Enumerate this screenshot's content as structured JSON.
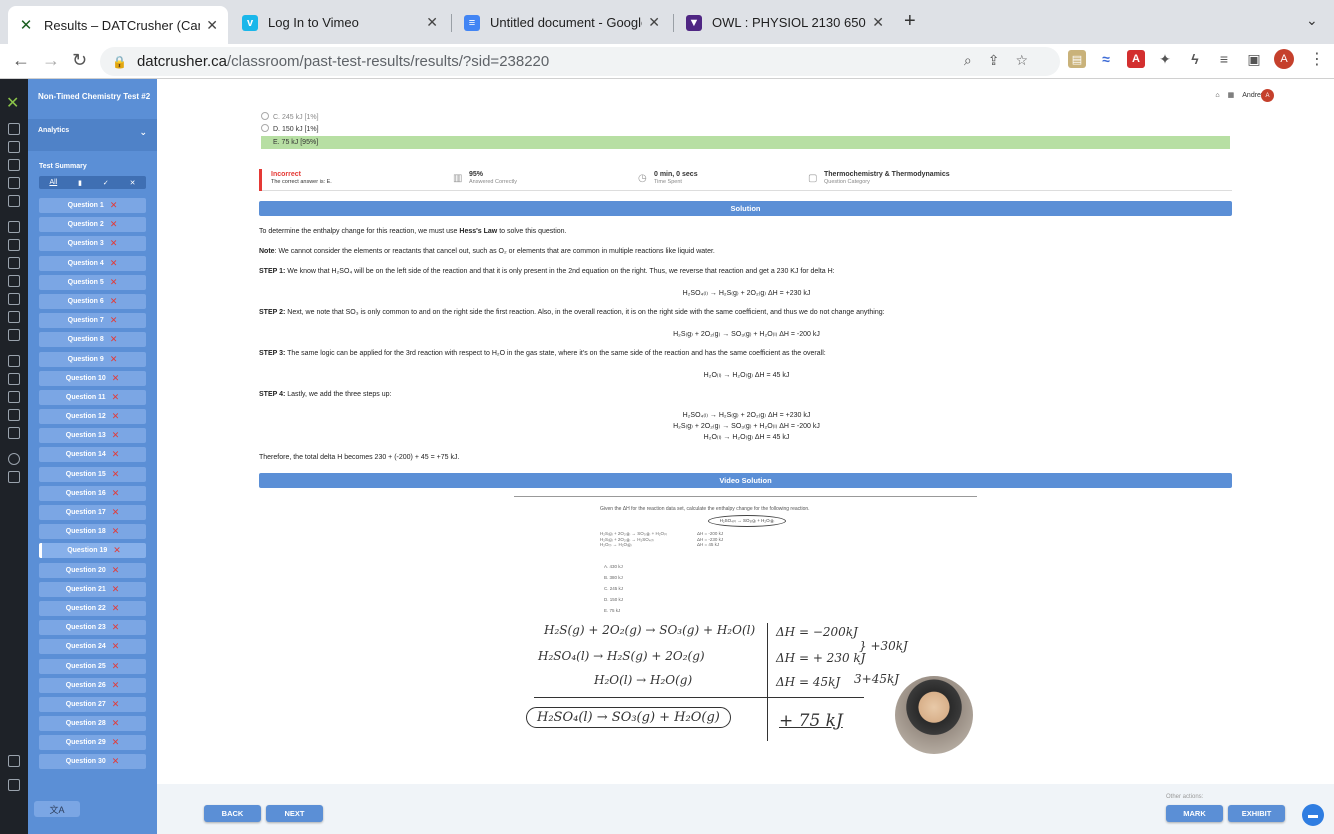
{
  "browser": {
    "tabs": [
      {
        "title": "Results – DATCrusher (Canadia",
        "active": true,
        "icon": "datcrusher-x-icon"
      },
      {
        "title": "Log In to Vimeo",
        "active": false,
        "icon": "vimeo-icon"
      },
      {
        "title": "Untitled document - Google Do",
        "active": false,
        "icon": "google-docs-icon"
      },
      {
        "title": "OWL : PHYSIOL 2130 650 SU2",
        "active": false,
        "icon": "owl-shield-icon"
      }
    ],
    "url_host": "datcrusher.ca",
    "url_path": "/classroom/past-test-results/results/?sid=238220",
    "profile_initial": "A"
  },
  "sidebar": {
    "test_title": "Non-Timed Chemistry Test #2",
    "analytics_label": "Analytics",
    "summary_label": "Test Summary",
    "filter_all": "All",
    "questions": [
      "Question 1",
      "Question 2",
      "Question 3",
      "Question 4",
      "Question 5",
      "Question 6",
      "Question 7",
      "Question 8",
      "Question 9",
      "Question 10",
      "Question 11",
      "Question 12",
      "Question 13",
      "Question 14",
      "Question 15",
      "Question 16",
      "Question 17",
      "Question 18",
      "Question 19",
      "Question 20",
      "Question 21",
      "Question 22",
      "Question 23",
      "Question 24",
      "Question 25",
      "Question 26",
      "Question 27",
      "Question 28",
      "Question 29",
      "Question 30"
    ],
    "current_question": 19,
    "lang_label": "文A"
  },
  "header": {
    "user_name": "Andrew",
    "user_initial": "A"
  },
  "answers": {
    "c": "C. 245 kJ [1%]",
    "d": "D. 150 kJ [1%]",
    "e": "E. 75 kJ [95%]"
  },
  "status": {
    "result": "Incorrect",
    "correct_answer": "The correct answer is: E.",
    "percent": "95%",
    "percent_label": "Answered Correctly",
    "time": "0 min, 0 secs",
    "time_label": "Time Spent",
    "category": "Thermochemistry & Thermodynamics",
    "category_label": "Question Category"
  },
  "solution": {
    "header": "Solution",
    "intro_pre": "To determine the enthalpy change for this reaction, we must use ",
    "intro_bold": "Hess's Law",
    "intro_post": " to solve this question.",
    "note_label": "Note",
    "note_text": ": We cannot consider the elements or reactants that cancel out, such as O₂ or elements that are common in multiple reactions like liquid water.",
    "step1_label": "STEP 1:",
    "step1_text": " We know that H₂SO₄ will be on the left side of the reaction and that it is only present in the 2nd equation on the right. Thus, we reverse that reaction and get a 230 KJ for delta H:",
    "eq1": "H₂SO₄₍ₗ₎ → H₂S₍g₎ + 2O₂₍g₎        ΔH = +230 kJ",
    "step2_label": "STEP 2:",
    "step2_text": " Next, we note that SO₃ is only common to and on the right side the first reaction. Also, in the overall reaction, it is on the right side with the same coefficient, and thus we do not change anything:",
    "eq2": "H₂S₍g₎ + 2O₂₍g₎ → SO₃₍g₎ + H₂O₍ₗ₎        ΔH = -200 kJ",
    "step3_label": "STEP 3:",
    "step3_text": " The same logic can be applied for the 3rd reaction with respect to H₂O in the gas state, where it's on the same side of the reaction and has the same coefficient as the overall:",
    "eq3": "H₂O₍ₗ₎ → H₂O₍g₎        ΔH = 45 kJ",
    "step4_label": "STEP 4:",
    "step4_text": " Lastly, we add the three steps up:",
    "sum1": "H₂SO₄₍ₗ₎ → H₂S₍g₎ + 2O₂₍g₎     ΔH = +230 kJ",
    "sum2": "H₂S₍g₎ + 2O₂₍g₎ → SO₃₍g₎ + H₂O₍ₗ₎     ΔH = -200 kJ",
    "sum3": "H₂O₍ₗ₎ → H₂O₍g₎     ΔH = 45 kJ",
    "conclusion": "Therefore, the total delta H becomes 230 + (-200) + 45 = +75 kJ."
  },
  "video": {
    "header": "Video Solution",
    "question": "Given the ΔH for the reaction data set, calculate the enthalpy change for the following reaction.",
    "target": "H₂SO₄₍ₗ₎ → SO₃₍g₎ + H₂O₍g₎",
    "given_rxns": [
      "H₂S₍g₎ + 2O₂₍g₎ → SO₃₍g₎ + H₂O₍ₗ₎",
      "H₂S₍g₎ + 2O₂₍g₎ → H₂SO₄₍ₗ₎",
      "H₂O₍ₗ₎ → H₂O₍g₎"
    ],
    "given_dh": [
      "ΔH = -200 kJ",
      "ΔH = -230 kJ",
      "ΔH = 45 kJ"
    ],
    "choices": [
      "A. 430 kJ",
      "B. 380 kJ",
      "C. 245 kJ",
      "D. 150 kJ",
      "E. 75 kJ"
    ],
    "hw1": "H₂S(g) + 2O₂(g) → SO₃(g) + H₂O(l)",
    "hw2": "H₂SO₄(l) → H₂S(g) + 2O₂(g)",
    "hw3": "H₂O(l) → H₂O(g)",
    "hwdh1": "ΔH = −200kJ",
    "hwdh2": "ΔH = + 230 kJ",
    "hwdh3": "ΔH = 45kJ",
    "hwbrace1": "} +30kJ",
    "hwbrace2": "3+45kJ",
    "hwresult": "H₂SO₄(l) → SO₃(g) + H₂O(g)",
    "hwanswer": "+ 75 kJ"
  },
  "footer": {
    "back": "BACK",
    "next": "NEXT",
    "other_actions": "Other actions:",
    "mark": "MARK",
    "exhibit": "EXHIBIT"
  }
}
